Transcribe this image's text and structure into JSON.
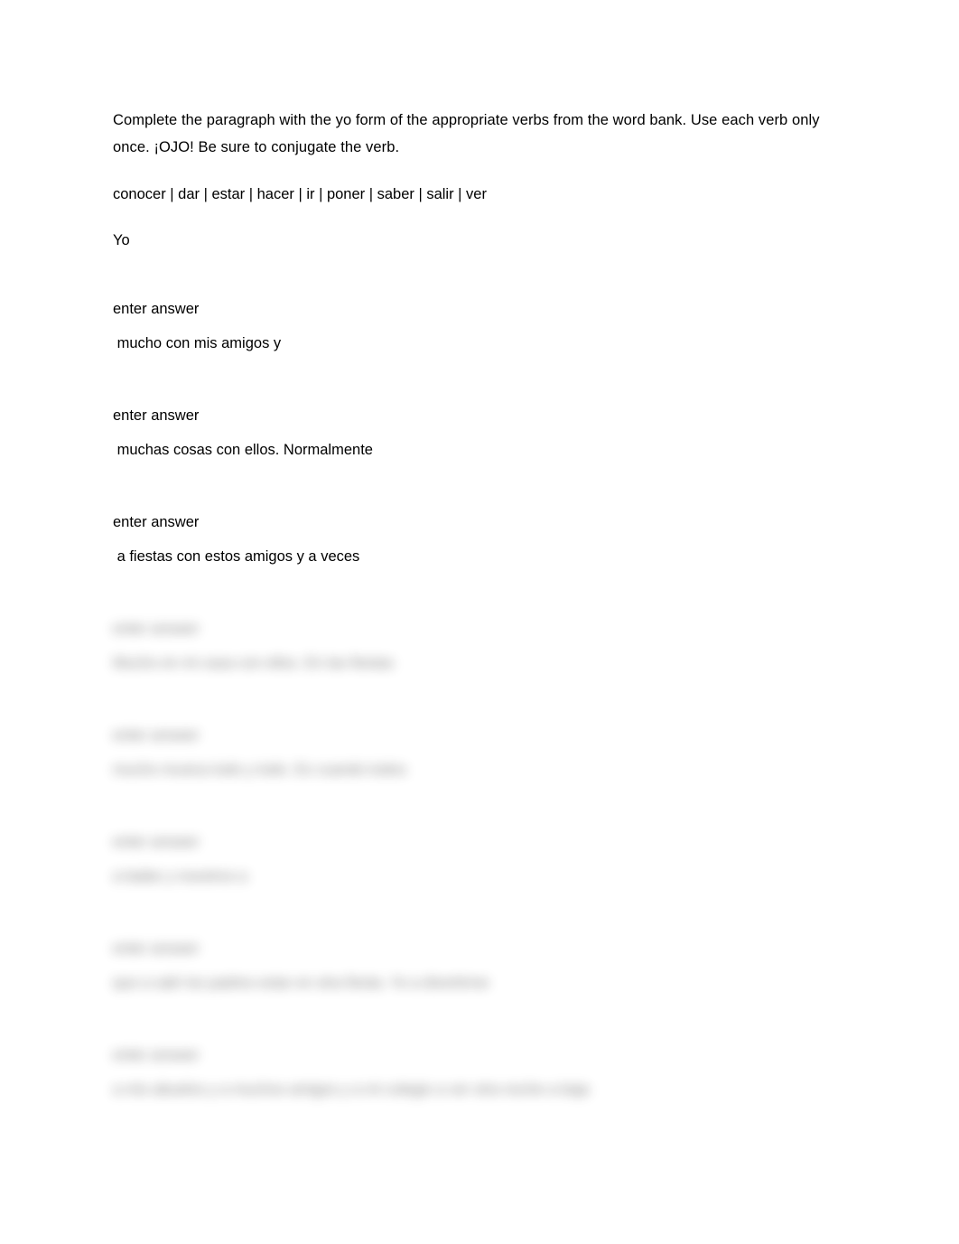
{
  "document": {
    "background_color": "#ffffff",
    "text_color": "#000000",
    "instructions": "Complete the paragraph with the yo form of the appropriate verbs from the word bank. Use each verb only once. ¡OJO! Be sure to conjugate the verb.",
    "word_bank": "conocer | dar | estar | hacer | ir | poner | saber | salir | ver",
    "lead_in": "Yo"
  },
  "answer_blocks": [
    {
      "slot_label": "enter answer",
      "tail_text": " mucho con mis amigos y",
      "blurred": false
    },
    {
      "slot_label": "enter answer",
      "tail_text": " muchas cosas con ellos. Normalmente",
      "blurred": false
    },
    {
      "slot_label": "enter answer",
      "tail_text": " a fiestas con estos amigos y a veces",
      "blurred": false
    },
    {
      "slot_label": "enter answer",
      "tail_text": "Mucho en mi casa con ellos. En las fiestas",
      "blurred": true
    },
    {
      "slot_label": "enter answer",
      "tail_text": "mucho musica todo y todo. Es cuando todos",
      "blurred": true
    },
    {
      "slot_label": "enter answer",
      "tail_text": "a bailar y nosotros a",
      "blurred": true
    },
    {
      "slot_label": "enter answer",
      "tail_text": "que a salir los padres estar en otra fiesta. Yo a divertirme",
      "blurred": true
    },
    {
      "slot_label": "enter answer",
      "tail_text": "a mis abuelos y a muchos amigos y a mi colegio a ver otra noche a baja",
      "blurred": true
    }
  ]
}
